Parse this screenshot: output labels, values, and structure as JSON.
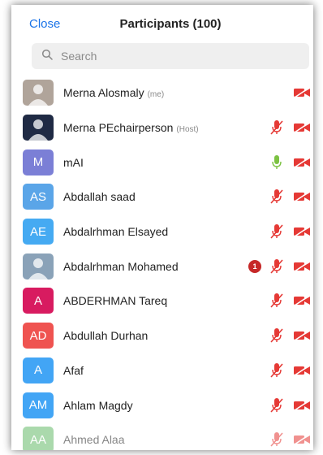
{
  "header": {
    "close_label": "Close",
    "title": "Participants (100)"
  },
  "search": {
    "placeholder": "Search"
  },
  "participants": [
    {
      "name": "Merna Alosmaly",
      "tag": "(me)",
      "initials": "",
      "avatar_color": "#b0a49a",
      "mic": "none",
      "camera": "off"
    },
    {
      "name": "Merna PEchairperson",
      "tag": "(Host)",
      "initials": "",
      "avatar_color": "#1f2a44",
      "mic": "muted",
      "camera": "off"
    },
    {
      "name": "mAI",
      "tag": "",
      "initials": "M",
      "avatar_color": "#7b7fd6",
      "mic": "on",
      "camera": "off"
    },
    {
      "name": "Abdallah saad",
      "tag": "",
      "initials": "AS",
      "avatar_color": "#5aa5e8",
      "mic": "muted",
      "camera": "off"
    },
    {
      "name": "Abdalrhman Elsayed",
      "tag": "",
      "initials": "AE",
      "avatar_color": "#45aaf2",
      "mic": "muted",
      "camera": "off"
    },
    {
      "name": "Abdalrhman Mohamed",
      "tag": "",
      "initials": "",
      "avatar_color": "#8aa2b8",
      "mic": "muted",
      "camera": "off",
      "badge": "1"
    },
    {
      "name": "ABDERHMAN Tareq",
      "tag": "",
      "initials": "A",
      "avatar_color": "#d81b60",
      "mic": "muted",
      "camera": "off"
    },
    {
      "name": "Abdullah Durhan",
      "tag": "",
      "initials": "AD",
      "avatar_color": "#ef5350",
      "mic": "muted",
      "camera": "off"
    },
    {
      "name": "Afaf",
      "tag": "",
      "initials": "A",
      "avatar_color": "#42a5f5",
      "mic": "muted",
      "camera": "off"
    },
    {
      "name": "Ahlam Magdy",
      "tag": "",
      "initials": "AM",
      "avatar_color": "#42a5f5",
      "mic": "muted",
      "camera": "off"
    },
    {
      "name": "Ahmed Alaa",
      "tag": "",
      "initials": "AA",
      "avatar_color": "#66bb6a",
      "mic": "muted",
      "camera": "off"
    }
  ],
  "colors": {
    "accent": "#1a73e8",
    "muted_red": "#e53935",
    "mic_green": "#7cc242"
  }
}
